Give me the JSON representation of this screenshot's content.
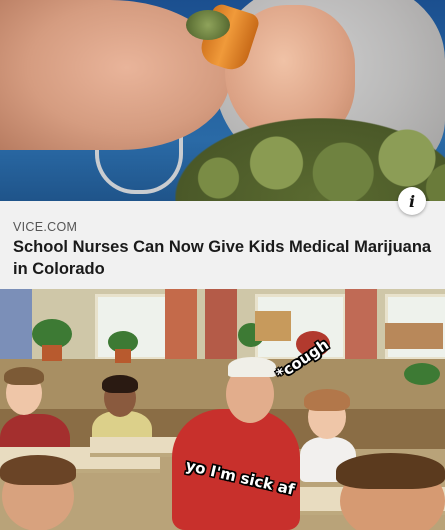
{
  "article": {
    "source": "VICE.COM",
    "headline": "School Nurses Can Now Give Kids Medical Marijuana in Colorado",
    "info_icon": "info-icon"
  },
  "meme": {
    "caption_cough": "*cough",
    "caption_sick": "yo I'm sick af"
  },
  "colors": {
    "caption_background": "#f1f1f1",
    "headline_text": "#1a1a1a",
    "source_text": "#555555",
    "meme_text_fill": "#ffffff",
    "meme_text_outline": "#000000"
  }
}
